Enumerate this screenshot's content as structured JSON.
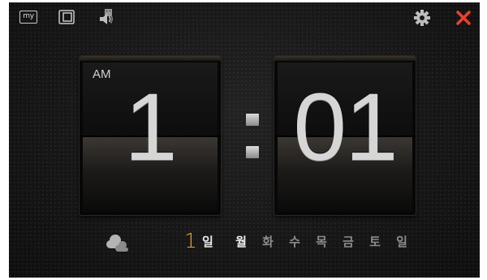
{
  "toolbar": {
    "my_label": "my",
    "icons": [
      "my-icon",
      "window-icon",
      "sound-icon",
      "gear-icon",
      "close-icon"
    ]
  },
  "clock": {
    "ampm": "AM",
    "hours": "1",
    "minutes": "01"
  },
  "date": {
    "weather_icon": "cloud-icon",
    "day": "1",
    "day_unit": "일",
    "weekdays": [
      "월",
      "화",
      "수",
      "목",
      "금",
      "토",
      "일"
    ],
    "active_weekday": "월"
  },
  "colors": {
    "accent": "#f0a030",
    "close": "#e8412c",
    "digits": "#d6d6d6"
  }
}
